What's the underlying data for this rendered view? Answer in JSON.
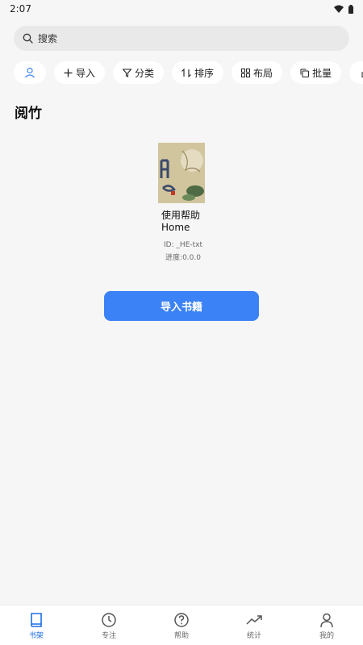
{
  "status": {
    "time": "2:07"
  },
  "search": {
    "placeholder": "搜索"
  },
  "toolbar": {
    "import": "导入",
    "category": "分类",
    "sort": "排序",
    "layout": "布局",
    "batch": "批量"
  },
  "section": {
    "title": "阅竹"
  },
  "book": {
    "title": "使用帮助Home",
    "id": "ID: _HE-txt",
    "progress": "进度:0.0.0"
  },
  "import_button": "导入书籍",
  "nav": [
    {
      "label": "书架"
    },
    {
      "label": "专注"
    },
    {
      "label": "帮助"
    },
    {
      "label": "统计"
    },
    {
      "label": "我的"
    }
  ],
  "colors": {
    "accent": "#3b82f6",
    "nav_active": "#1e6fe8"
  }
}
